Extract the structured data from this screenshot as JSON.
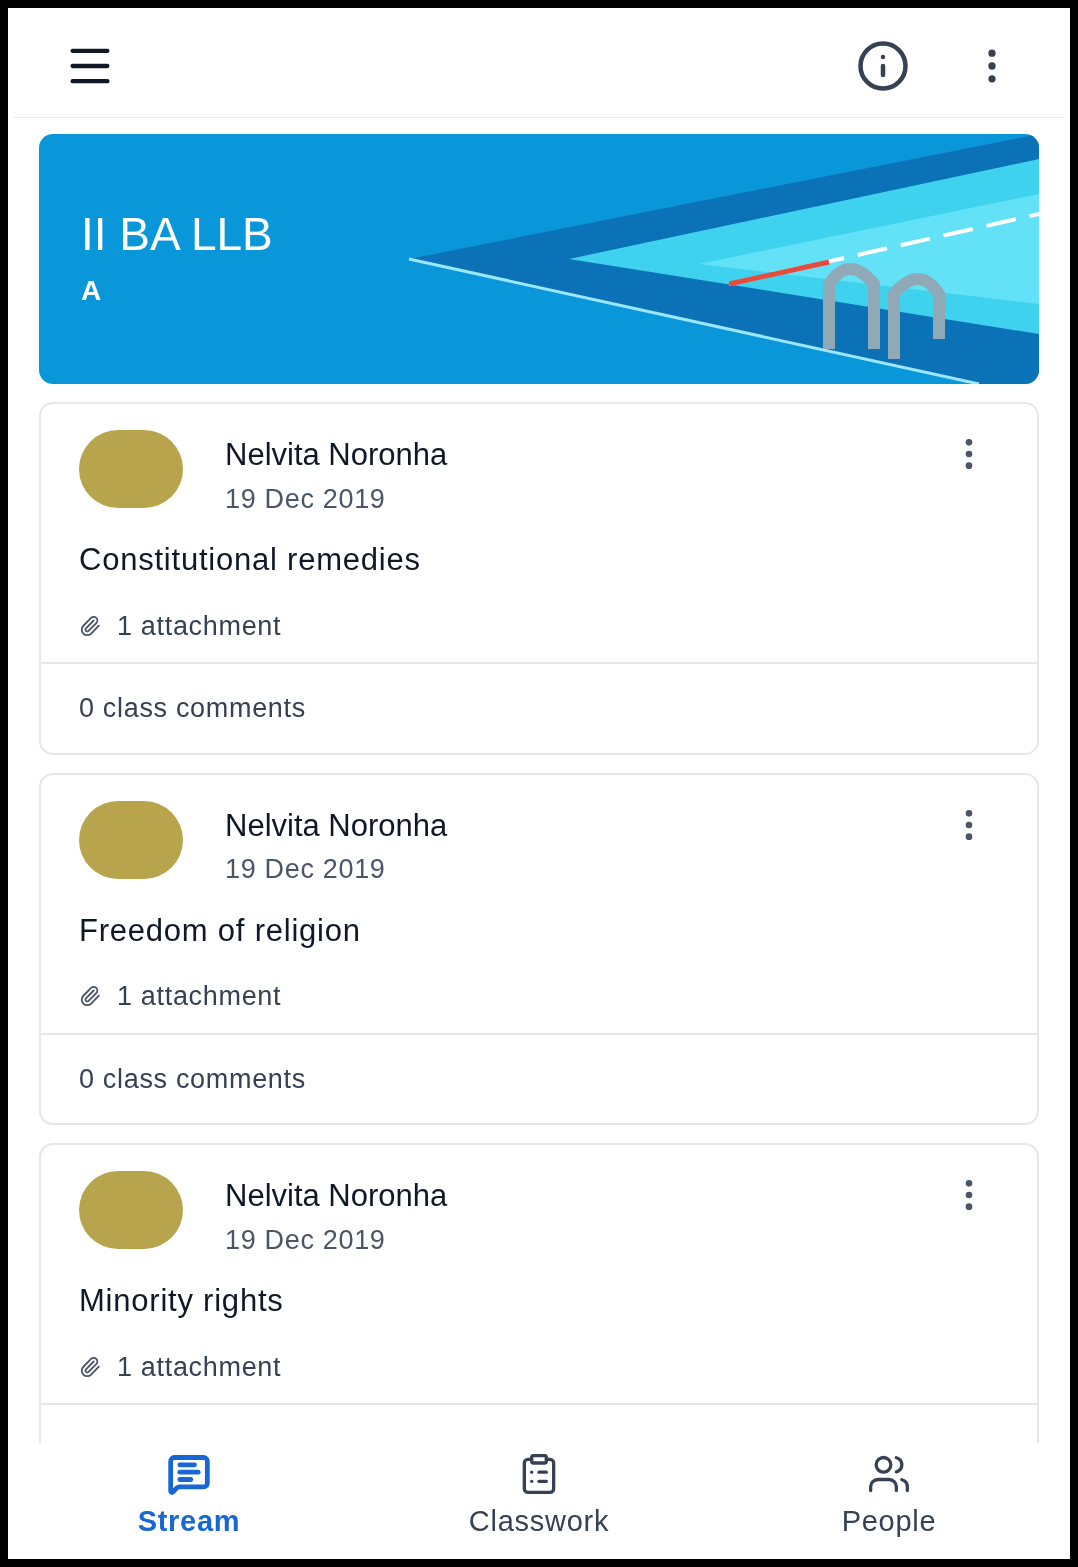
{
  "class_banner": {
    "title": "II BA LLB",
    "section": "A"
  },
  "posts": [
    {
      "author": "Nelvita Noronha",
      "date": "19 Dec 2019",
      "title": "Constitutional remedies",
      "attachments": "1 attachment",
      "comments": "0 class comments"
    },
    {
      "author": "Nelvita Noronha",
      "date": "19 Dec 2019",
      "title": "Freedom of religion",
      "attachments": "1 attachment",
      "comments": "0 class comments"
    },
    {
      "author": "Nelvita Noronha",
      "date": "19 Dec 2019",
      "title": "Minority rights",
      "attachments": "1 attachment"
    }
  ],
  "bottom_nav": [
    {
      "kind": "stream",
      "label": "Stream",
      "selected": true
    },
    {
      "kind": "classwork",
      "label": "Classwork",
      "selected": false
    },
    {
      "kind": "people",
      "label": "People",
      "selected": false
    }
  ]
}
